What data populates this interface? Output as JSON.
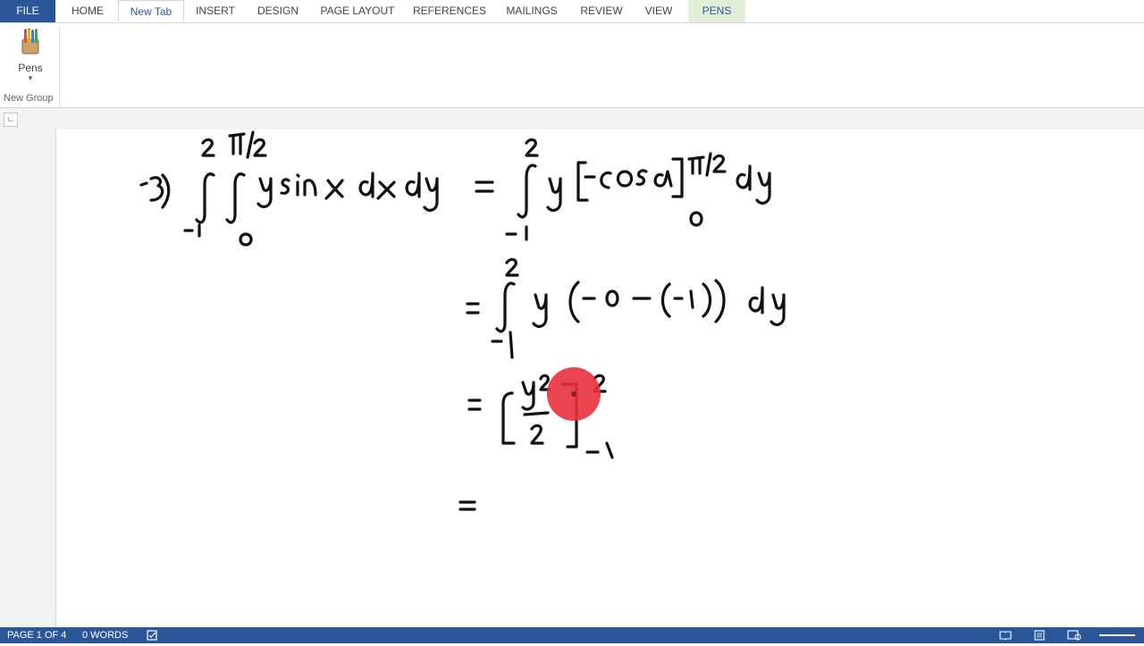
{
  "ribbon_tabs": [
    {
      "label": "FILE"
    },
    {
      "label": "HOME"
    },
    {
      "label": "New Tab"
    },
    {
      "label": "INSERT"
    },
    {
      "label": "DESIGN"
    },
    {
      "label": "PAGE LAYOUT"
    },
    {
      "label": "REFERENCES"
    },
    {
      "label": "MAILINGS"
    },
    {
      "label": "REVIEW"
    },
    {
      "label": "VIEW"
    },
    {
      "label": "PENS"
    }
  ],
  "active_tab": "New Tab",
  "ribbon": {
    "pens_button_label": "Pens",
    "group_label": "New Group"
  },
  "statusbar": {
    "page_info": "PAGE 1 OF 4",
    "word_count": "0 WORDS"
  },
  "colors": {
    "accent": "#2b579a",
    "pens_tab_bg": "#e2efd9",
    "laser_pointer": "#e8313b"
  },
  "icons": [
    "pens-icon",
    "proofing-icon",
    "read-mode-icon",
    "print-layout-icon",
    "web-layout-icon"
  ]
}
